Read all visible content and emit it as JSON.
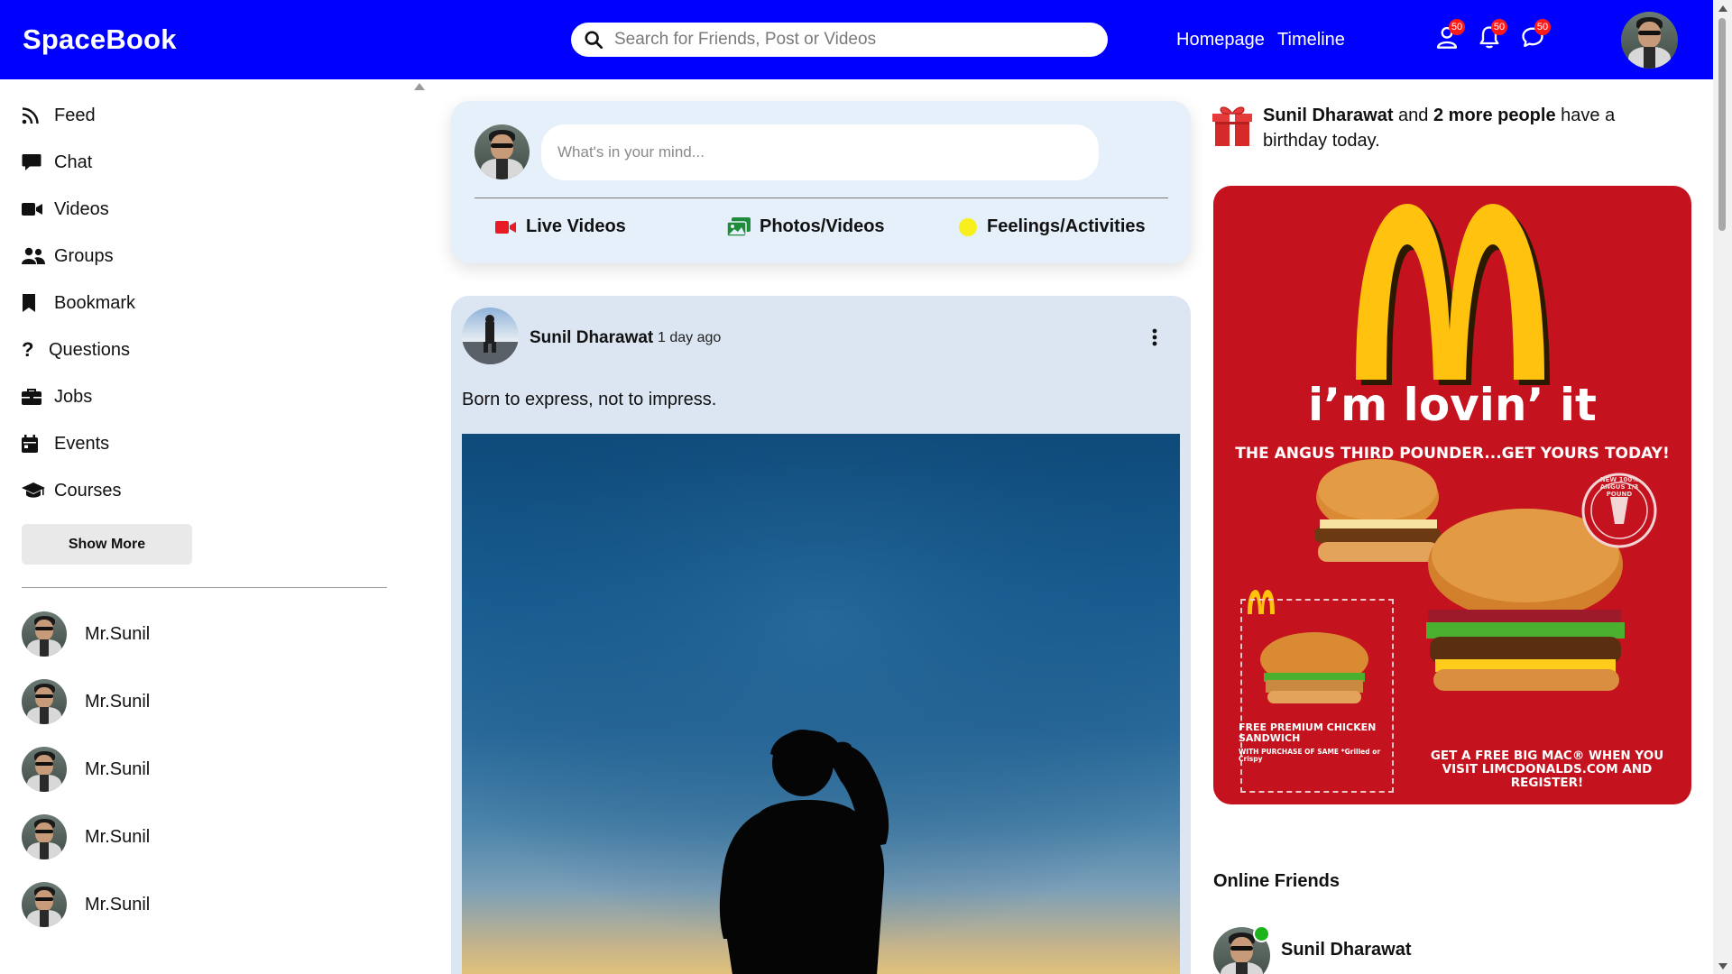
{
  "header": {
    "logo": "SpaceBook",
    "search_placeholder": "Search for Friends, Post or Videos",
    "nav_links": [
      "Homepage",
      "Timeline"
    ],
    "badges": {
      "friend_requests": "50",
      "notifications": "50",
      "messages": "50"
    }
  },
  "sidebar": {
    "items": [
      {
        "label": "Feed",
        "icon": "rss-feed-icon"
      },
      {
        "label": "Chat",
        "icon": "chat-icon"
      },
      {
        "label": "Videos",
        "icon": "video-camera-icon"
      },
      {
        "label": "Groups",
        "icon": "users-group-icon"
      },
      {
        "label": "Bookmark",
        "icon": "bookmark-icon"
      },
      {
        "label": "Questions",
        "icon": "question-icon"
      },
      {
        "label": "Jobs",
        "icon": "briefcase-icon"
      },
      {
        "label": "Events",
        "icon": "calendar-icon"
      },
      {
        "label": "Courses",
        "icon": "graduation-cap-icon"
      }
    ],
    "show_more_label": "Show More",
    "friends": [
      "Mr.Sunil",
      "Mr.Sunil",
      "Mr.Sunil",
      "Mr.Sunil",
      "Mr.Sunil"
    ]
  },
  "share": {
    "placeholder": "What's in your mind...",
    "options": [
      "Live Videos",
      "Photos/Videos",
      "Feelings/Activities"
    ],
    "option_colors": [
      "#e81c24",
      "#1e8c3a",
      "#f7f01e"
    ]
  },
  "post": {
    "author": "Sunil Dharawat",
    "time": "1 day ago",
    "text": "Born to express, not to impress."
  },
  "birthday": {
    "name": "Sunil Dharawat",
    "connector": "and",
    "others": "2 more people",
    "rest": "have a birthday today."
  },
  "ad": {
    "slogan": "i’m lovin’ it",
    "subtitle": "THE ANGUS THIRD POUNDER...GET YOURS TODAY!",
    "coupon_text": "FREE PREMIUM CHICKEN SANDWICH",
    "coupon_sub": "WITH PURCHASE OF SAME *Grilled or Crispy",
    "promo_text": "GET A FREE BIG MAC® WHEN YOU VISIT LIMCDONALDS.COM AND REGISTER!",
    "seal_text": "NEW 100% ANGUS 1/3 POUND"
  },
  "online": {
    "title": "Online Friends",
    "friends": [
      "Sunil Dharawat"
    ]
  },
  "colors": {
    "header_bg": "#0000ff",
    "share_bg": "#e6f0fa",
    "post_bg": "#dce6f2",
    "ad_bg": "#c4121e",
    "online_dot": "#1db31d"
  }
}
